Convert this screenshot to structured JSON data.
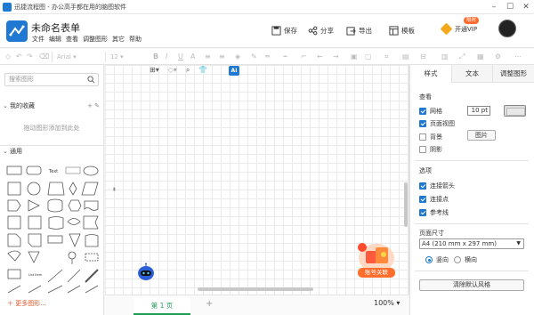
{
  "window": {
    "title": "迅捷流程图 - 办公高手都在用的脑图软件"
  },
  "header": {
    "doc_title": "未命名表单",
    "menu": [
      "文件",
      "编辑",
      "查看",
      "调整图形",
      "其它",
      "帮助"
    ],
    "buttons": {
      "save": "保存",
      "share": "分享",
      "export": "导出",
      "template": "模板"
    },
    "vip": {
      "label": "开通VIP",
      "badge": "限时"
    }
  },
  "toolbar": {
    "font": "Arial",
    "font_size": "12"
  },
  "left_panel": {
    "search_placeholder": "搜索图形",
    "favorites": {
      "title": "我的收藏",
      "hint": "拖动图形添加到此处"
    },
    "general": {
      "title": "通用"
    },
    "more_shapes": "更多图形..."
  },
  "canvas": {
    "ai_label": "AI",
    "promo_label": "账号关联"
  },
  "bottom": {
    "page_tab": "第 1 页",
    "zoom": "100%"
  },
  "right_panel": {
    "tabs": [
      "样式",
      "文本",
      "调整图形"
    ],
    "view": {
      "title": "查看",
      "grid": "网格",
      "grid_size": "10 pt",
      "page_view": "页面视图",
      "background": "背景",
      "image_button": "图片",
      "shadow": "阴影"
    },
    "options": {
      "title": "选项",
      "connection_arrows": "连接箭头",
      "connection_points": "连接点",
      "guides": "参考线"
    },
    "page_size": {
      "title": "页面尺寸",
      "value": "A4 (210 mm x 297 mm)",
      "portrait": "竖向",
      "landscape": "横向"
    },
    "reset_button": "清除默认风格"
  }
}
